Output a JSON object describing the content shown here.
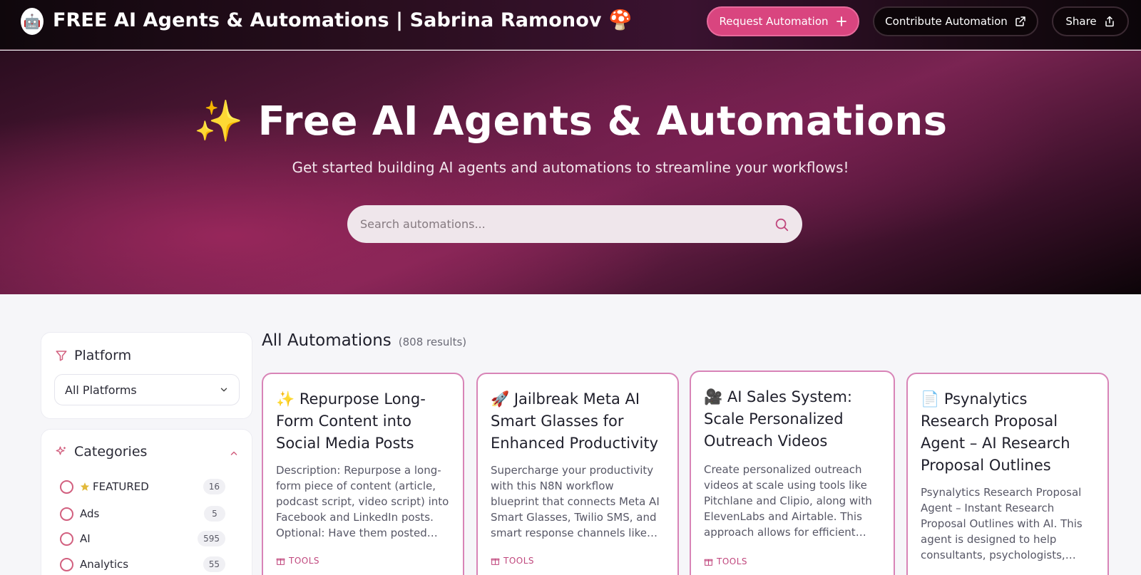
{
  "header": {
    "logo_glyph": "🤖",
    "title": "FREE AI Agents & Automations | Sabrina Ramonov 🍄",
    "request_label": "Request Automation",
    "contribute_label": "Contribute Automation",
    "share_label": "Share"
  },
  "hero": {
    "title": "✨ Free AI Agents & Automations",
    "subtitle": "Get started building AI agents and automations to streamline your workflows!",
    "search_placeholder": "Search automations..."
  },
  "sidebar": {
    "platform": {
      "heading": "Platform",
      "selected": "All Platforms"
    },
    "categories": {
      "heading": "Categories",
      "items": [
        {
          "label": "FEATURED",
          "count": "16",
          "star": true
        },
        {
          "label": "Ads",
          "count": "5"
        },
        {
          "label": "AI",
          "count": "595"
        },
        {
          "label": "Analytics",
          "count": "55"
        }
      ]
    }
  },
  "main": {
    "heading": "All Automations",
    "result_count": "(808 results)",
    "cards": [
      {
        "title": "✨ Repurpose Long-Form Content into Social Media Posts",
        "description": "Description: Repurpose a long-form piece of content (article, podcast script, video script) into Facebook and LinkedIn posts. Optional: Have them posted for...",
        "tag": "TOOLS"
      },
      {
        "title": "🚀 Jailbreak Meta AI Smart Glasses for Enhanced Productivity",
        "description": "Supercharge your productivity with this N8N workflow blueprint that connects Meta AI Smart Glasses, Twilio SMS, and smart response channels like WhatsAp...",
        "tag": "TOOLS"
      },
      {
        "title": "🎥 AI Sales System: Scale Personalized Outreach Videos",
        "description": "Create personalized outreach videos at scale using tools like Pitchlane and Clipio, along with ElevenLabs and Airtable. This approach allows for efficient and...",
        "tag": "TOOLS"
      },
      {
        "title": "📄 Psynalytics Research Proposal Agent – AI Research Proposal Outlines",
        "description": "Psynalytics Research Proposal Agent – Instant Research Proposal Outlines with AI. This agent is designed to help consultants, psychologists, and...",
        "tag": ""
      }
    ]
  },
  "colors": {
    "accent_pink": "#d9457f",
    "card_border": "#d884b7",
    "tag_color": "#c0477d",
    "star_color": "#e2b93b"
  }
}
